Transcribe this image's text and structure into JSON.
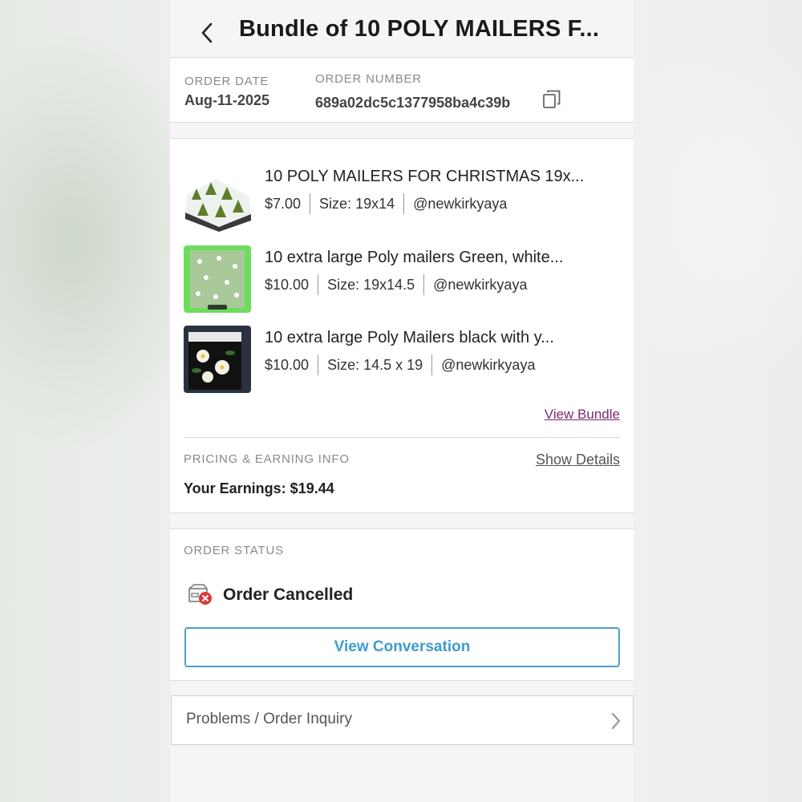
{
  "header": {
    "title": "Bundle of 10 POLY MAILERS F..."
  },
  "order": {
    "date_label": "ORDER DATE",
    "date_value": "Aug-11-2025",
    "number_label": "ORDER NUMBER",
    "number_value": "689a02dc5c1377958ba4c39b"
  },
  "items": [
    {
      "title": "10 POLY MAILERS FOR CHRISTMAS 19x...",
      "price": "$7.00",
      "size": "Size: 19x14",
      "seller": "@newkirkyaya"
    },
    {
      "title": "10 extra large Poly mailers Green, white...",
      "price": "$10.00",
      "size": "Size: 19x14.5",
      "seller": "@newkirkyaya"
    },
    {
      "title": "10 extra large Poly Mailers black with y...",
      "price": "$10.00",
      "size": "Size: 14.5 x 19",
      "seller": "@newkirkyaya"
    }
  ],
  "bundle": {
    "view_bundle_label": "View Bundle"
  },
  "pricing": {
    "label": "PRICING & EARNING INFO",
    "show_details_label": "Show Details",
    "earnings": "Your Earnings: $19.44"
  },
  "status": {
    "label": "ORDER STATUS",
    "value": "Order Cancelled",
    "conversation_button": "View Conversation"
  },
  "inquiry": {
    "label": "Problems / Order Inquiry"
  },
  "colors": {
    "link_purple": "#7b2a6e",
    "button_blue": "#3d9ccb",
    "cancel_red": "#d83a3a"
  },
  "icons": {
    "back": "chevron-left-icon",
    "copy": "copy-icon",
    "status": "package-cancelled-icon",
    "inquiry": "chevron-right-icon"
  }
}
